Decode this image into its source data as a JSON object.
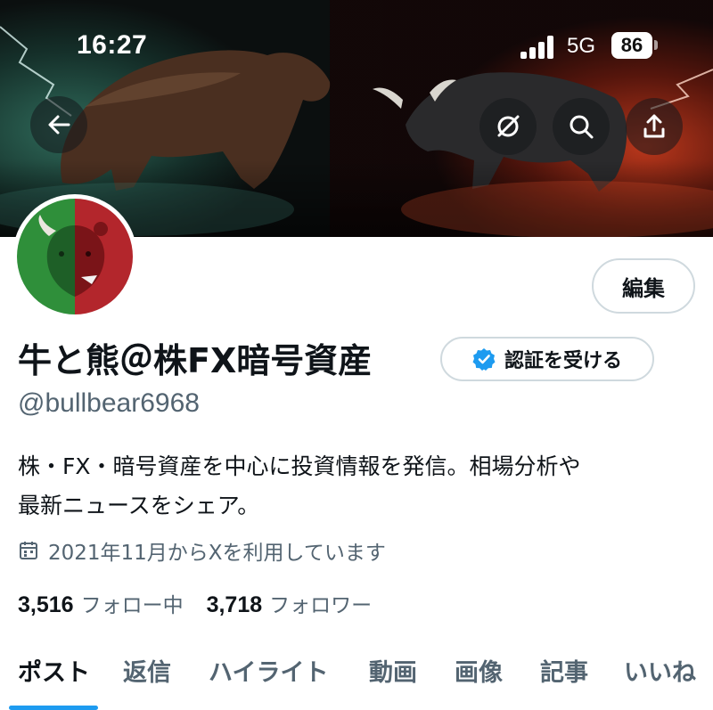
{
  "status_bar": {
    "time": "16:27",
    "network": "5G",
    "battery": "86"
  },
  "banner": {
    "icons": [
      "arrow-left-icon",
      "refresh-icon",
      "search-icon",
      "share-icon"
    ]
  },
  "profile": {
    "display_name": "牛と熊＠株FX暗号資産",
    "handle": "@bullbear6968",
    "bio_line1": "株・FX・暗号資産を中心に投資情報を発信。相場分析や",
    "bio_line2": "最新ニュースをシェア。",
    "joined": "2021年11月からXを利用しています",
    "following_count": "3,516",
    "following_label": "フォロー中",
    "followers_count": "3,718",
    "followers_label": "フォロワー"
  },
  "buttons": {
    "edit": "編集",
    "verify": "認証を受ける"
  },
  "tabs": [
    "ポスト",
    "返信",
    "ハイライト",
    "動画",
    "画像",
    "記事",
    "いいね"
  ],
  "active_tab": "ポスト",
  "colors": {
    "accent": "#1d9bf0",
    "text_primary": "#0f1419",
    "text_secondary": "#536471",
    "border": "#cfd9de"
  }
}
